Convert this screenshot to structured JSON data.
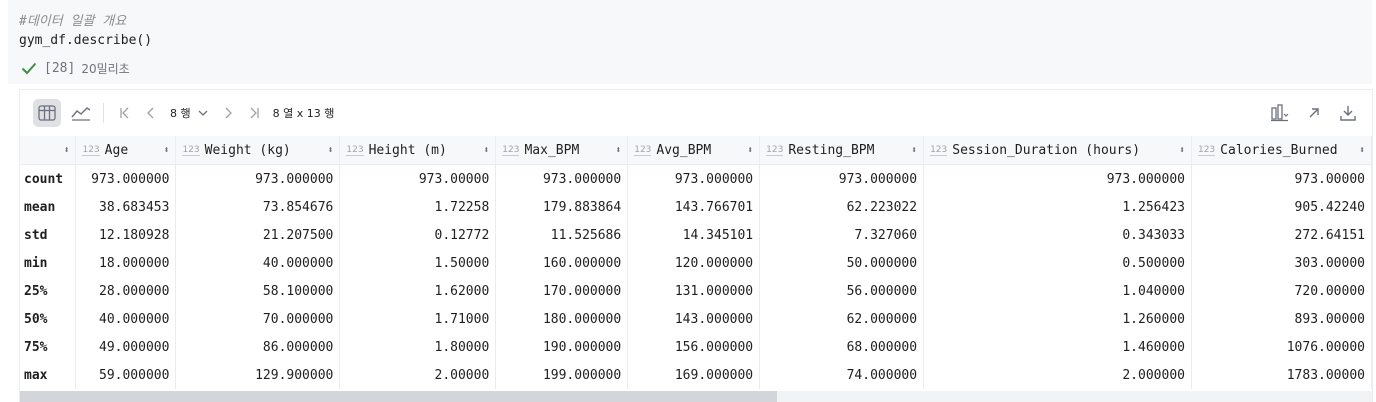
{
  "cell": {
    "comment": "#데이터 일괄 개요",
    "code": "gym_df.describe()",
    "exec_count": "[28]",
    "duration": "20밀리초"
  },
  "toolbar": {
    "rows_label": "8 행",
    "shape_label": "8 열 x 13 행"
  },
  "table": {
    "type_badge": "123",
    "index_header": "",
    "columns": [
      "Age",
      "Weight (kg)",
      "Height (m)",
      "Max_BPM",
      "Avg_BPM",
      "Resting_BPM",
      "Session_Duration (hours)",
      "Calories_Burned"
    ],
    "rows": [
      {
        "label": "count",
        "values": [
          "973.000000",
          "973.000000",
          "973.00000",
          "973.000000",
          "973.000000",
          "973.000000",
          "973.000000",
          "973.00000"
        ]
      },
      {
        "label": "mean",
        "values": [
          "38.683453",
          "73.854676",
          "1.72258",
          "179.883864",
          "143.766701",
          "62.223022",
          "1.256423",
          "905.42240"
        ]
      },
      {
        "label": "std",
        "values": [
          "12.180928",
          "21.207500",
          "0.12772",
          "11.525686",
          "14.345101",
          "7.327060",
          "0.343033",
          "272.64151"
        ]
      },
      {
        "label": "min",
        "values": [
          "18.000000",
          "40.000000",
          "1.50000",
          "160.000000",
          "120.000000",
          "50.000000",
          "0.500000",
          "303.00000"
        ]
      },
      {
        "label": "25%",
        "values": [
          "28.000000",
          "58.100000",
          "1.62000",
          "170.000000",
          "131.000000",
          "56.000000",
          "1.040000",
          "720.00000"
        ]
      },
      {
        "label": "50%",
        "values": [
          "40.000000",
          "70.000000",
          "1.71000",
          "180.000000",
          "143.000000",
          "62.000000",
          "1.260000",
          "893.00000"
        ]
      },
      {
        "label": "75%",
        "values": [
          "49.000000",
          "86.000000",
          "1.80000",
          "190.000000",
          "156.000000",
          "68.000000",
          "1.460000",
          "1076.00000"
        ]
      },
      {
        "label": "max",
        "values": [
          "59.000000",
          "129.900000",
          "2.00000",
          "199.000000",
          "169.000000",
          "74.000000",
          "2.000000",
          "1783.00000"
        ]
      }
    ]
  },
  "colors": {
    "success": "#3e8e41",
    "header_bg": "#f7f8fa",
    "border": "#ebecf0"
  },
  "icons": {
    "status": "check-icon",
    "table_view": "table-icon",
    "chart_view": "chart-icon",
    "first_page": "first-page-icon",
    "prev_page": "prev-page-icon",
    "rows_dropdown": "chevron-down-icon",
    "next_page": "next-page-icon",
    "last_page": "last-page-icon",
    "visualize": "bar-chart-icon",
    "open_external": "arrow-up-right-icon",
    "download": "download-icon",
    "sort": "sort-icon"
  }
}
